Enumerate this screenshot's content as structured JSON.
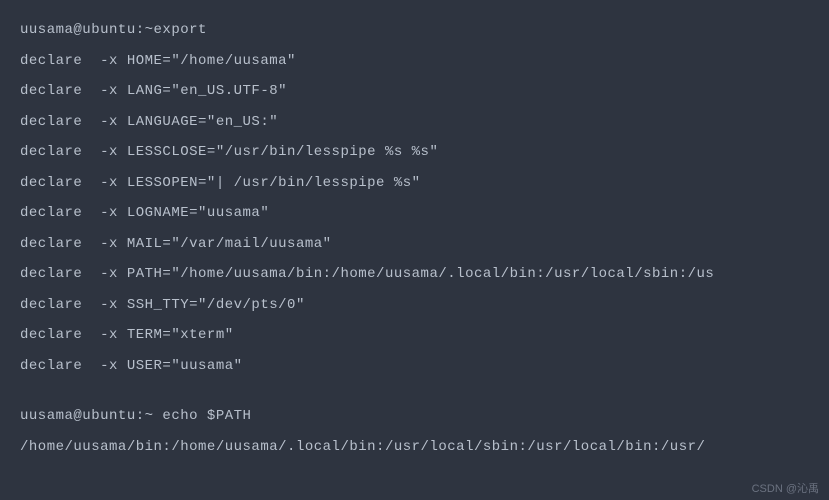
{
  "terminal": {
    "lines": [
      "uusama@ubuntu:~export",
      "declare  -x HOME=\"/home/uusama\"",
      "declare  -x LANG=\"en_US.UTF-8\"",
      "declare  -x LANGUAGE=\"en_US:\"",
      "declare  -x LESSCLOSE=\"/usr/bin/lesspipe %s %s\"",
      "declare  -x LESSOPEN=\"| /usr/bin/lesspipe %s\"",
      "declare  -x LOGNAME=\"uusama\"",
      "declare  -x MAIL=\"/var/mail/uusama\"",
      "declare  -x PATH=\"/home/uusama/bin:/home/uusama/.local/bin:/usr/local/sbin:/us",
      "declare  -x SSH_TTY=\"/dev/pts/0\"",
      "declare  -x TERM=\"xterm\"",
      "declare  -x USER=\"uusama\"",
      "",
      "uusama@ubuntu:~ echo $PATH",
      "/home/uusama/bin:/home/uusama/.local/bin:/usr/local/sbin:/usr/local/bin:/usr/"
    ]
  },
  "watermark": "CSDN @沁禹"
}
